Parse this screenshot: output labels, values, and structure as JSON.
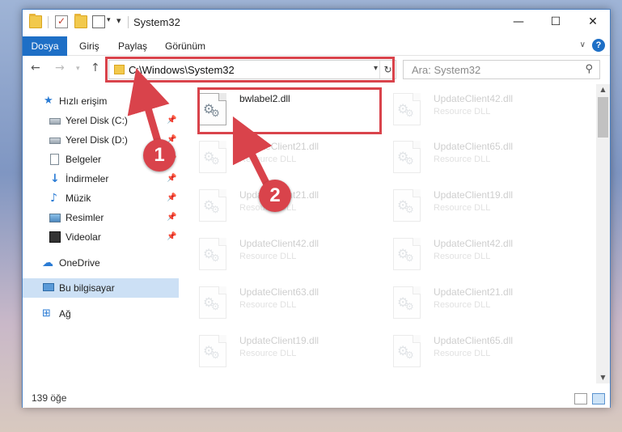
{
  "window": {
    "title": "System32",
    "controls": {
      "minimize": "—",
      "maximize": "☐",
      "close": "✕"
    }
  },
  "ribbon": {
    "tabs": [
      "Dosya",
      "Giriş",
      "Paylaş",
      "Görünüm"
    ],
    "help": "?"
  },
  "address": {
    "path": "C:\\Windows\\System32",
    "search_placeholder": "Ara: System32"
  },
  "nav": {
    "quick_access": "Hızlı erişim",
    "items": [
      {
        "label": "Yerel Disk (C:)",
        "icon": "drive-icon",
        "pinned": true
      },
      {
        "label": "Yerel Disk (D:)",
        "icon": "drive-icon",
        "pinned": true
      },
      {
        "label": "Belgeler",
        "icon": "documents-icon",
        "pinned": true
      },
      {
        "label": "İndirmeler",
        "icon": "downloads-icon",
        "pinned": true
      },
      {
        "label": "Müzik",
        "icon": "music-icon",
        "pinned": true
      },
      {
        "label": "Resimler",
        "icon": "pictures-icon",
        "pinned": true
      },
      {
        "label": "Videolar",
        "icon": "videos-icon",
        "pinned": true
      }
    ],
    "onedrive": "OneDrive",
    "this_pc": "Bu bilgisayar",
    "network": "Ağ"
  },
  "files": [
    {
      "name": "bwlabel2.dll",
      "type": ""
    },
    {
      "name": "UpdateClient42.dll",
      "type": "Resource DLL"
    },
    {
      "name": "UpdateClient21.dll",
      "type": "Resource DLL"
    },
    {
      "name": "UpdateClient65.dll",
      "type": "Resource DLL"
    },
    {
      "name": "UpdateClient21.dll",
      "type": "Resource DLL"
    },
    {
      "name": "UpdateClient19.dll",
      "type": "Resource DLL"
    },
    {
      "name": "UpdateClient42.dll",
      "type": "Resource DLL"
    },
    {
      "name": "UpdateClient42.dll",
      "type": "Resource DLL"
    },
    {
      "name": "UpdateClient63.dll",
      "type": "Resource DLL"
    },
    {
      "name": "UpdateClient21.dll",
      "type": "Resource DLL"
    },
    {
      "name": "UpdateClient19.dll",
      "type": "Resource DLL"
    },
    {
      "name": "UpdateClient65.dll",
      "type": "Resource DLL"
    }
  ],
  "status": {
    "item_count": "139 öğe"
  },
  "callouts": {
    "step1": "1",
    "step2": "2"
  },
  "colors": {
    "accent": "#1e6fc6",
    "highlight": "#d9434b",
    "selected": "#cce0f5"
  }
}
